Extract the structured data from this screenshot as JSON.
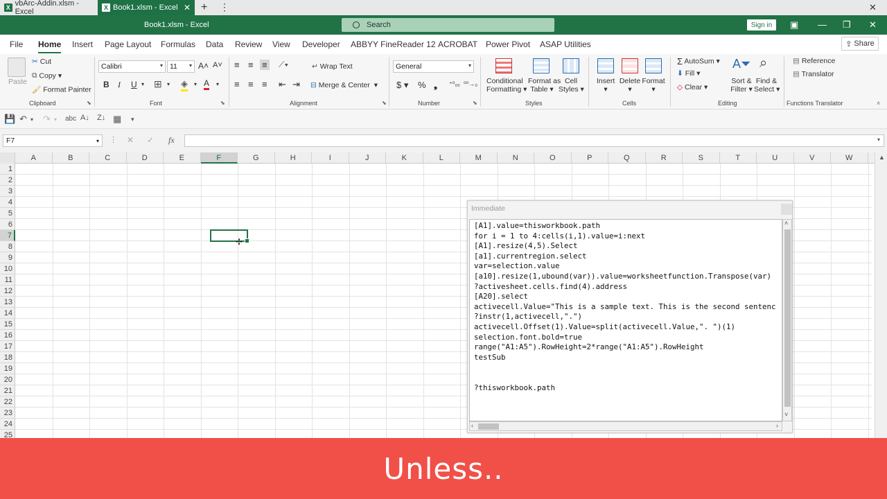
{
  "tabs": [
    {
      "label": "vbArc-Addin.xlsm - Excel",
      "active": false
    },
    {
      "label": "Book1.xlsm - Excel",
      "active": true
    }
  ],
  "window": {
    "title": "Book1.xlsm  -  Excel",
    "search_placeholder": "Search",
    "signin_label": "Sign in"
  },
  "menu": {
    "items": [
      "File",
      "Home",
      "Insert",
      "Page Layout",
      "Formulas",
      "Data",
      "Review",
      "View",
      "Developer",
      "ABBYY FineReader 12",
      "ACROBAT",
      "Power Pivot",
      "ASAP Utilities"
    ],
    "active": "Home",
    "share_label": "Share"
  },
  "ribbon": {
    "clipboard": {
      "paste": "Paste",
      "cut": "Cut",
      "copy": "Copy",
      "format_painter": "Format Painter",
      "label": "Clipboard"
    },
    "font": {
      "name": "Calibri",
      "size": "11",
      "label": "Font"
    },
    "alignment": {
      "wrap": "Wrap Text",
      "merge": "Merge & Center",
      "label": "Alignment"
    },
    "number": {
      "format": "General",
      "label": "Number"
    },
    "styles": {
      "conditional_1": "Conditional",
      "conditional_2": "Formatting",
      "table_1": "Format as",
      "table_2": "Table",
      "cell_1": "Cell",
      "cell_2": "Styles",
      "label": "Styles"
    },
    "cells": {
      "insert": "Insert",
      "delete": "Delete",
      "format": "Format",
      "label": "Cells"
    },
    "editing": {
      "autosum": "AutoSum",
      "fill": "Fill",
      "clear": "Clear",
      "sort_1": "Sort &",
      "sort_2": "Filter",
      "find_1": "Find &",
      "find_2": "Select",
      "label": "Editing"
    },
    "translator": {
      "reference": "Reference",
      "translator": "Translator",
      "label": "Functions Translator"
    }
  },
  "formula_bar": {
    "name_box": "F7",
    "fx": "fx",
    "formula": ""
  },
  "sheet": {
    "columns": [
      "A",
      "B",
      "C",
      "D",
      "E",
      "F",
      "G",
      "H",
      "I",
      "J",
      "K",
      "L",
      "M",
      "N",
      "O",
      "P",
      "Q",
      "R",
      "S",
      "T",
      "U",
      "V",
      "W"
    ],
    "rows": [
      "1",
      "2",
      "3",
      "4",
      "5",
      "6",
      "7",
      "8",
      "9",
      "10",
      "11",
      "12",
      "13",
      "14",
      "15",
      "16",
      "17",
      "18",
      "19",
      "20",
      "21",
      "22",
      "23",
      "24",
      "25"
    ],
    "active_column": "F",
    "active_row": "7"
  },
  "immediate": {
    "title": "Immediate",
    "lines": [
      "[A1].value=thisworkbook.path",
      "for i = 1 to 4:cells(i,1).value=i:next",
      "[A1].resize(4,5).Select",
      "[a1].currentregion.select",
      "var=selection.value",
      "[a10].resize(1,ubound(var)).value=worksheetfunction.Transpose(var)",
      "?activesheet.cells.find(4).address",
      "[A20].select",
      "activecell.Value=\"This is a sample text. This is the second sentenc",
      "?instr(1,activecell,\".\")",
      "activecell.Offset(1).Value=split(activecell.Value,\". \")(1)",
      "selection.font.bold=true",
      "range(\"A1:A5\").RowHeight=2*range(\"A1:A5\").RowHeight",
      "testSub",
      "",
      "",
      "?thisworkbook.path"
    ]
  },
  "caption": {
    "text": "Unless.."
  },
  "colors": {
    "excel_green": "#217346",
    "banner": "#f05048"
  }
}
